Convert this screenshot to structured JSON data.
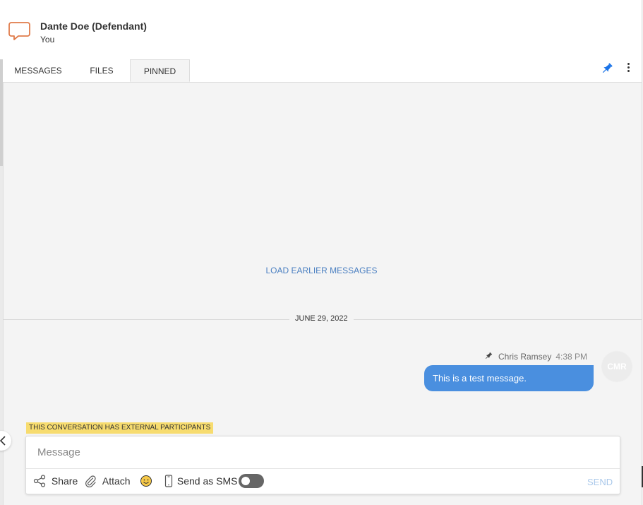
{
  "header": {
    "title": "Dante Doe (Defendant)",
    "subtitle": "You"
  },
  "tabs": [
    {
      "label": "MESSAGES",
      "active": false
    },
    {
      "label": "FILES",
      "active": false
    },
    {
      "label": "PINNED",
      "active": true
    }
  ],
  "icons": {
    "header_icon": "speech-bubble-icon",
    "pin": "pin-icon",
    "more": "kebab-menu-icon"
  },
  "messages_area": {
    "load_earlier": "LOAD EARLIER MESSAGES",
    "date_divider": "JUNE 29, 2022",
    "message": {
      "sender": "Chris Ramsey",
      "time": "4:38 PM",
      "text": "This is a test message.",
      "avatar_initials": "CMR",
      "pinned": true
    }
  },
  "external_banner": "THIS CONVERSATION HAS EXTERNAL PARTICIPANTS",
  "composer": {
    "placeholder": "Message",
    "value": "",
    "share_label": "Share",
    "attach_label": "Attach",
    "sms_label": "Send as SMS",
    "sms_enabled": false,
    "send_label": "SEND"
  },
  "colors": {
    "accent_blue": "#4a8fdf",
    "link_blue": "#4a7fc1",
    "icon_orange": "#e07b4a",
    "banner_yellow": "#f7dc6f",
    "pin_blue": "#1a73e8"
  }
}
